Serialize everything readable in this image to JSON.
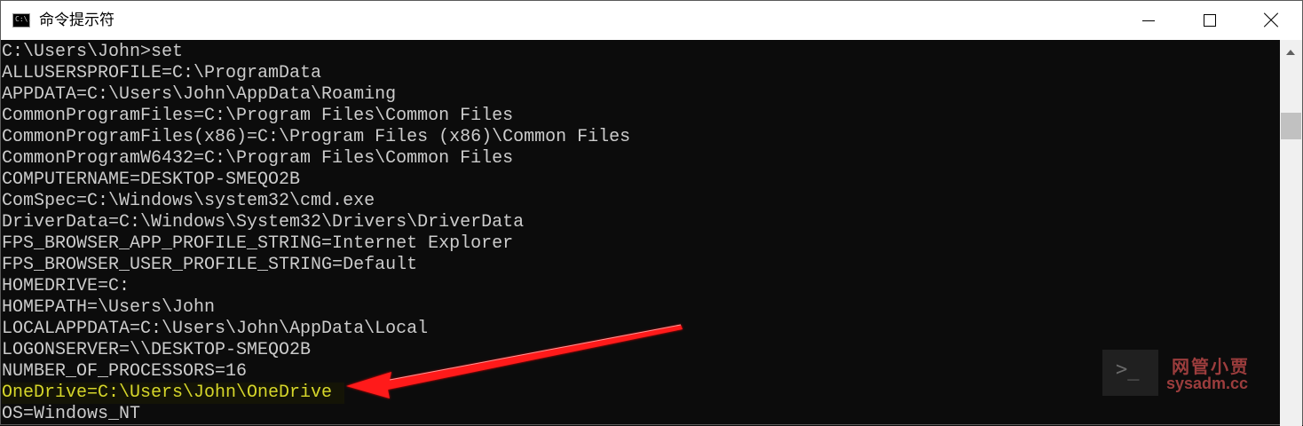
{
  "window": {
    "title": "命令提示符",
    "icon_text": "C:\\.",
    "controls": [
      "minimize",
      "maximize",
      "close"
    ]
  },
  "console": {
    "lines": [
      "C:\\Users\\John>set",
      "ALLUSERSPROFILE=C:\\ProgramData",
      "APPDATA=C:\\Users\\John\\AppData\\Roaming",
      "CommonProgramFiles=C:\\Program Files\\Common Files",
      "CommonProgramFiles(x86)=C:\\Program Files (x86)\\Common Files",
      "CommonProgramW6432=C:\\Program Files\\Common Files",
      "COMPUTERNAME=DESKTOP-SMEQO2B",
      "ComSpec=C:\\Windows\\system32\\cmd.exe",
      "DriverData=C:\\Windows\\System32\\Drivers\\DriverData",
      "FPS_BROWSER_APP_PROFILE_STRING=Internet Explorer",
      "FPS_BROWSER_USER_PROFILE_STRING=Default",
      "HOMEDRIVE=C:",
      "HOMEPATH=\\Users\\John",
      "LOCALAPPDATA=C:\\Users\\John\\AppData\\Local",
      "LOGONSERVER=\\\\DESKTOP-SMEQO2B",
      "NUMBER_OF_PROCESSORS=16",
      "OneDrive=C:\\Users\\John\\OneDrive",
      "OS=Windows_NT"
    ],
    "highlight_color": "#d6d62a",
    "text_color": "#cccccc",
    "background": "#0c0c0c"
  },
  "annotation": {
    "arrow_color": "#ff1a1a"
  },
  "watermark": {
    "icon_text": ">_",
    "cn_text": "网管小贾",
    "en_text": "sysadm.cc"
  }
}
